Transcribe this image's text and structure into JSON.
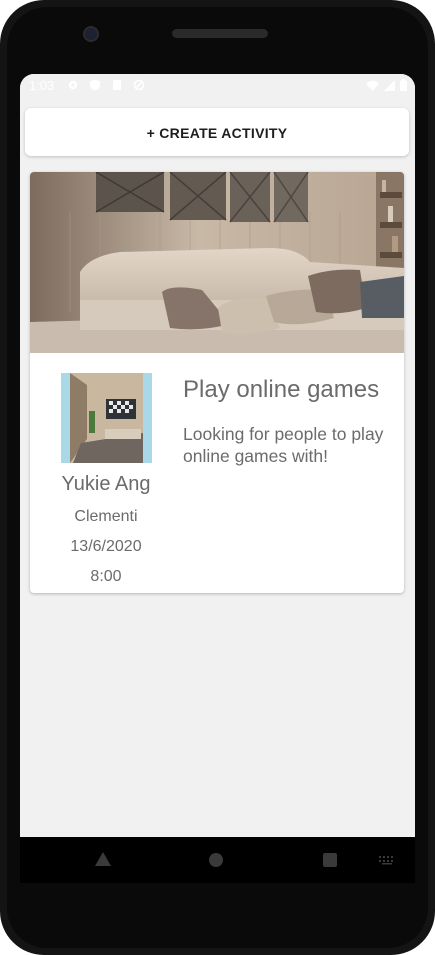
{
  "status_bar": {
    "time": "1:03",
    "icons_left": [
      "settings-icon",
      "shield-icon",
      "sd-card-icon",
      "sync-icon"
    ],
    "icons_right": [
      "wifi-icon",
      "signal-icon",
      "battery-icon"
    ]
  },
  "actions": {
    "create_label": "+ CREATE ACTIVITY"
  },
  "activities": [
    {
      "title": "Play online games",
      "description": "Looking for people to play online games with!",
      "host": {
        "name": "Yukie Ang",
        "location": "Clementi",
        "date": "13/6/2020",
        "time": "8:00"
      }
    }
  ],
  "nav_bar": {
    "icons": [
      "back-icon",
      "home-icon",
      "recents-icon",
      "keyboard-icon"
    ]
  },
  "colors": {
    "screen_background": "#f1f1f1",
    "card_background": "#ffffff",
    "text_secondary": "#6b6b6b",
    "button_text": "#1e1e1e"
  }
}
